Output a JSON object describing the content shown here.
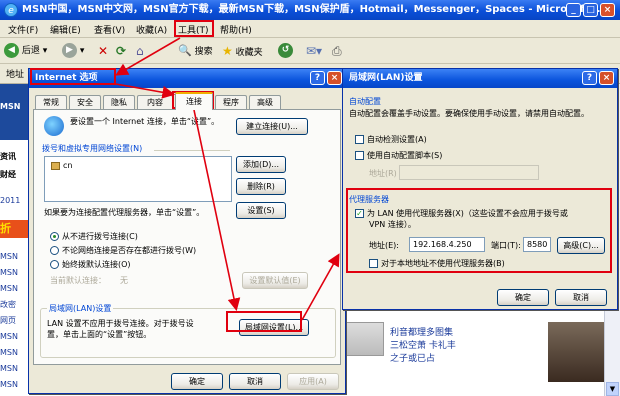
{
  "ie": {
    "title": "MSN中国，MSN中文网，MSN官方下载，最新MSN下载，MSN保护盾，Hotmail，Messenger，Spaces - Microsoft...",
    "menu": [
      "文件(F)",
      "编辑(E)",
      "查看(V)",
      "收藏(A)",
      "工具(T)",
      "帮助(H)"
    ],
    "toolbar": {
      "back": "后退",
      "search": "搜索",
      "favorites": "收藏夹"
    },
    "address_label": "地址"
  },
  "sidebar_text": [
    "资讯",
    "财经",
    "2011",
    "折",
    "MSN",
    "MSN",
    "MSN",
    "改密",
    "网页",
    "MSN",
    "MSN",
    "MSN",
    "MSN",
    "MSN"
  ],
  "background_news": {
    "line1": "利音都理多图集",
    "line2": "三松空萧 卡礼丰",
    "line3": "之子或已占"
  },
  "internet_options": {
    "title": "Internet 选项",
    "tabs": [
      "常规",
      "安全",
      "隐私",
      "内容",
      "连接",
      "程序",
      "高级"
    ],
    "setup_text": "要设置一个 Internet 连接，单击“设置”。",
    "setup_button": "建立连接(U)...",
    "dialup_group": "拨号和虚拟专用网络设置(N)",
    "dialup_items": [
      "cn"
    ],
    "add_button": "添加(D)...",
    "remove_button": "删除(R)",
    "settings_button": "设置(S)",
    "proxy_text": "如果要为连接配置代理服务器，单击“设置”。",
    "radio_never": "从不进行拨号连接(C)",
    "radio_whenever": "不论网络连接是否存在都进行拨号(W)",
    "radio_always": "始终拨默认连接(O)",
    "current_default_label": "当前默认连接：",
    "current_default_value": "无",
    "set_default_button": "设置默认值(E)",
    "lan_group": "局域网(LAN)设置",
    "lan_text1": "LAN 设置不应用于拨号连接。对于拨号设",
    "lan_text2": "置，单击上面的“设置”按钮。",
    "lan_button": "局域网设置(L)...",
    "ok": "确定",
    "cancel": "取消",
    "apply": "应用(A)"
  },
  "lan_dialog": {
    "title": "局域网(LAN)设置",
    "auto_group": "自动配置",
    "auto_desc": "自动配置会覆盖手动设置。要确保使用手动设置，请禁用自动配置。",
    "auto_detect": "自动检测设置(A)",
    "use_script": "使用自动配置脚本(S)",
    "address_label": "地址(R)",
    "proxy_group": "代理服务器",
    "use_proxy": "为 LAN 使用代理服务器(X)（这些设置不会应用于拨号或",
    "use_proxy_line2": "VPN 连接）。",
    "proxy_address_label": "地址(E):",
    "proxy_address": "192.168.4.250",
    "port_label": "端口(T):",
    "port": "8580",
    "advanced_button": "高级(C)...",
    "bypass_local": "对于本地地址不使用代理服务器(B)",
    "ok": "确定",
    "cancel": "取消"
  },
  "colors": {
    "xp_blue": "#0a53dc",
    "dialog_face": "#ece9d8",
    "highlight_red": "#e0000f"
  }
}
